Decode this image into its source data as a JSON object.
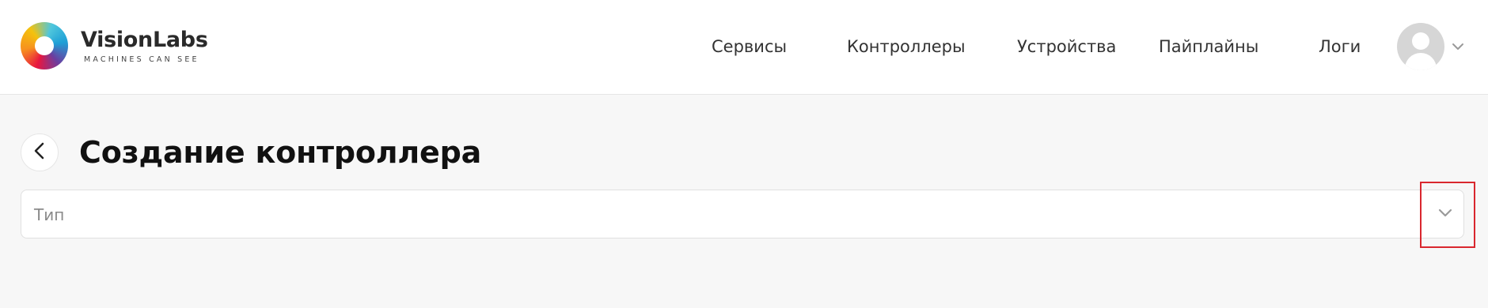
{
  "brand": {
    "name": "VisionLabs",
    "tagline": "MACHINES CAN SEE",
    "logo_icon": "vision-ring-logo"
  },
  "nav": {
    "items": [
      {
        "label": "Сервисы"
      },
      {
        "label": "Контроллеры"
      },
      {
        "label": "Устройства"
      },
      {
        "label": "Пайплайны"
      },
      {
        "label": "Логи"
      }
    ]
  },
  "user": {
    "avatar_icon": "user-avatar-icon",
    "menu_icon": "chevron-down-icon"
  },
  "page": {
    "title": "Создание контроллера",
    "back_icon": "chevron-left-icon"
  },
  "form": {
    "type_select": {
      "label": "Тип",
      "value": "",
      "icon": "chevron-down-icon"
    }
  },
  "colors": {
    "background": "#f7f7f7",
    "header": "#ffffff",
    "highlight": "#d9272e"
  }
}
